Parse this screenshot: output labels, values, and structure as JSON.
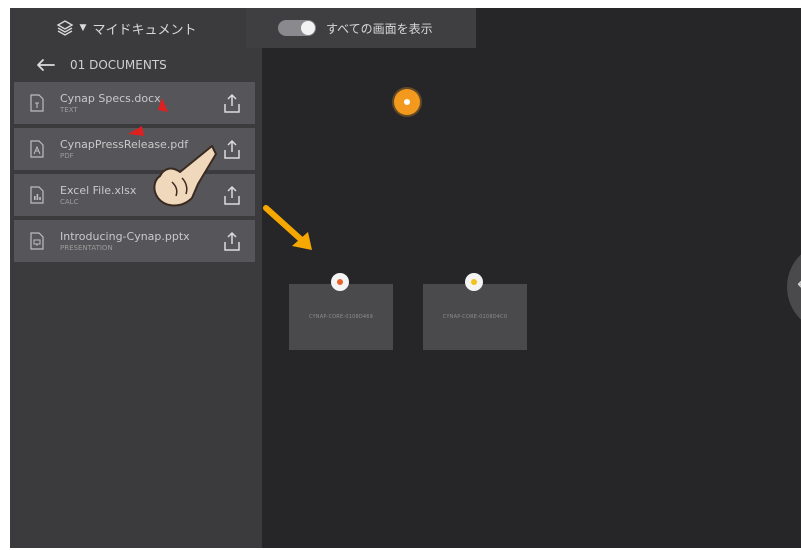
{
  "topbar": {
    "menu_title": "マイドキュメント",
    "toggle_label": "すべての画面を表示",
    "toggle_on": true
  },
  "sidebar": {
    "path_label": "01 DOCUMENTS",
    "files": [
      {
        "name": "Cynap Specs.docx",
        "type": "TEXT",
        "icon": "text-file-icon"
      },
      {
        "name": "CynapPressRelease.pdf",
        "type": "PDF",
        "icon": "pdf-file-icon"
      },
      {
        "name": "Excel File.xlsx",
        "type": "CALC",
        "icon": "calc-file-icon"
      },
      {
        "name": "Introducing-Cynap.pptx",
        "type": "PRESENTATION",
        "icon": "presentation-file-icon"
      }
    ]
  },
  "canvas": {
    "devices": [
      {
        "label": "CYNAP-CORE-0108D469",
        "pin_color": "#e8622a"
      },
      {
        "label": "CYNAP-CORE-0108D4C0",
        "pin_color": "#f2c21a"
      }
    ],
    "side_handle_glyph": "←"
  },
  "colors": {
    "background": "#262628",
    "sidebar": "#3b3b3e",
    "file_item": "#56565a",
    "accent_orange": "#f39a1e",
    "annotation_arrow": "#f7a800",
    "annotation_tap_marks": "#e02020"
  },
  "annotations": [
    "hand-pointer-icon",
    "tap-indicator-icon",
    "yellow-arrow-icon"
  ]
}
